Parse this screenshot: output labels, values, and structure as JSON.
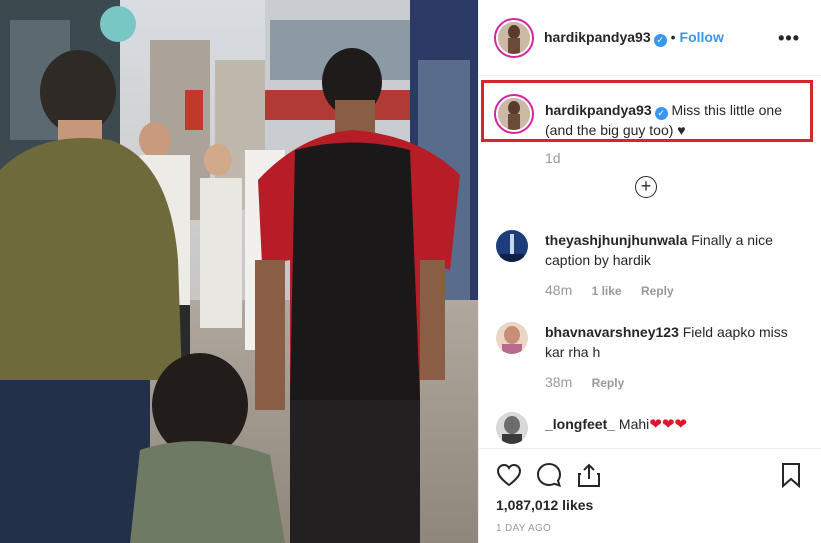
{
  "post": {
    "username": "hardikpandya93",
    "follow_label": "Follow",
    "separator": "•",
    "more_label": "•••"
  },
  "caption": {
    "username": "hardikpandya93",
    "text_line1": "Miss this little one",
    "text_line2": "(and the big guy too) ♥",
    "time": "1d"
  },
  "load_more_label": "+",
  "comments": [
    {
      "username": "theyashjhunjhunwala",
      "text": "Finally a nice caption by hardik",
      "time": "48m",
      "likes": "1 like",
      "reply": "Reply"
    },
    {
      "username": "bhavnavarshney123",
      "text": "Field aapko miss kar rha h",
      "time": "38m",
      "reply": "Reply"
    },
    {
      "username": "_longfeet_",
      "text": "Mahi",
      "hearts": "❤❤❤"
    }
  ],
  "footer": {
    "likes": "1,087,012 likes",
    "posted": "1 DAY AGO"
  },
  "colors": {
    "link": "#3897f0",
    "highlight": "#d5262e",
    "heart": "#e0142b"
  }
}
